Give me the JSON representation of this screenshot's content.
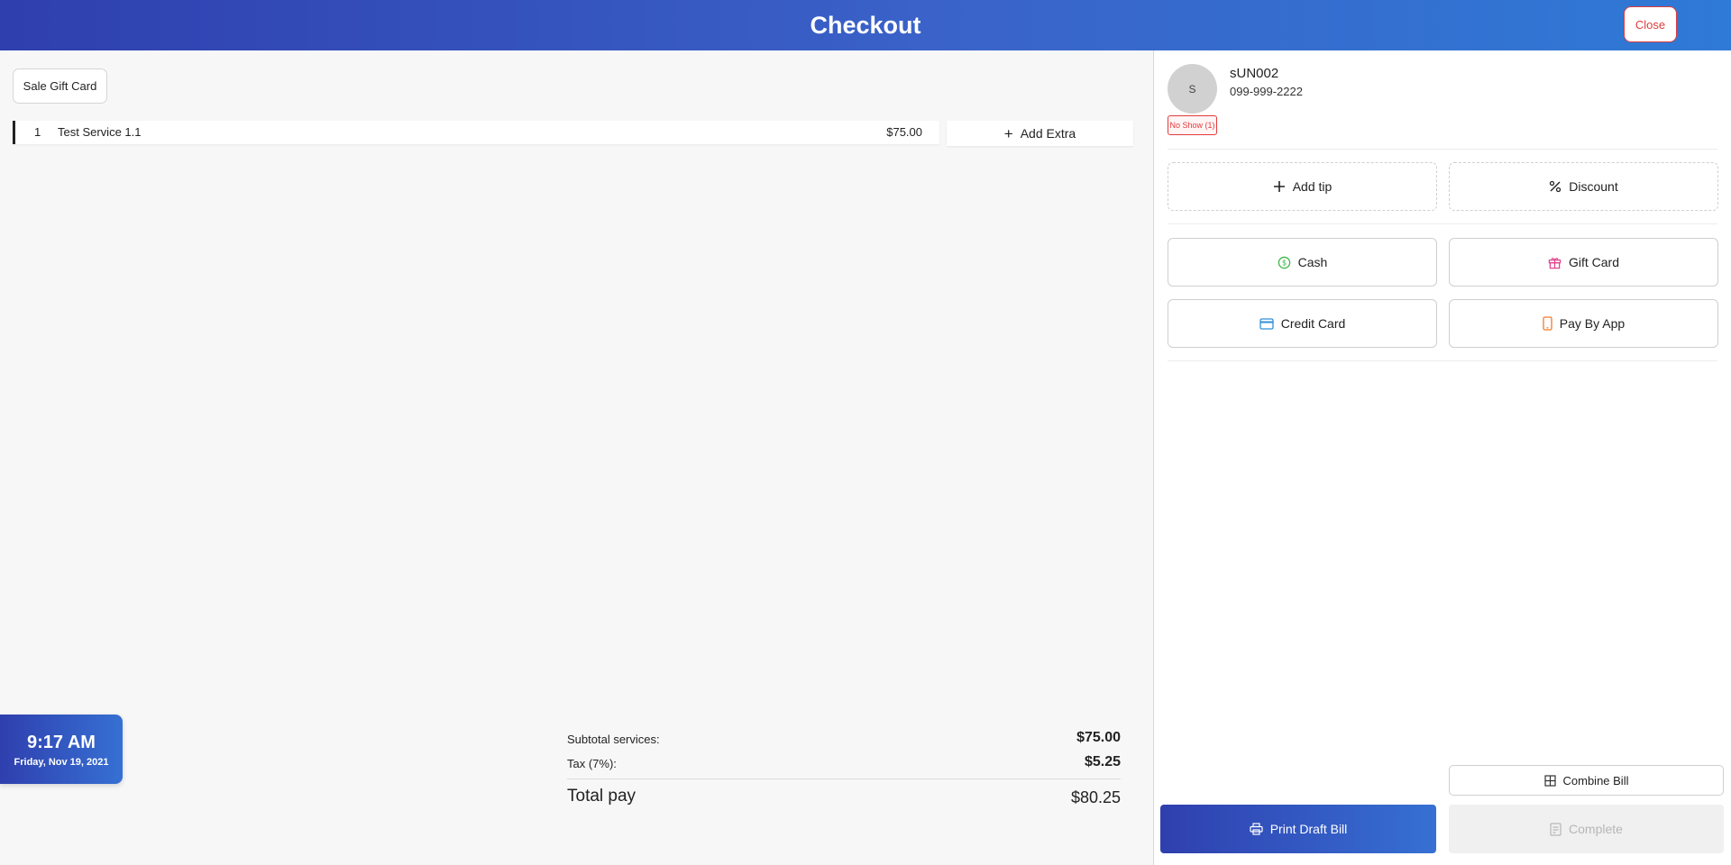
{
  "header": {
    "title": "Checkout",
    "close_label": "Close"
  },
  "left": {
    "sale_gift_card_label": "Sale Gift Card",
    "services": [
      {
        "index": "1",
        "name": "Test Service 1.1",
        "price": "$75.00"
      }
    ],
    "add_extra_label": "Add Extra"
  },
  "clock": {
    "time": "9:17 AM",
    "date": "Friday, Nov 19, 2021"
  },
  "totals": {
    "subtotal_label": "Subtotal services:",
    "subtotal_value": "$75.00",
    "tax_label": "Tax (7%):",
    "tax_value": "$5.25",
    "total_label": "Total pay",
    "total_value": "$80.25"
  },
  "customer": {
    "avatar_initial": "S",
    "name": "sUN002",
    "phone": "099-999-2222",
    "no_show_badge": "No Show (1)"
  },
  "options": {
    "add_tip_label": "Add tip",
    "discount_label": "Discount"
  },
  "payments": {
    "cash_label": "Cash",
    "gift_card_label": "Gift Card",
    "credit_card_label": "Credit Card",
    "pay_by_app_label": "Pay By App"
  },
  "actions": {
    "combine_bill_label": "Combine Bill",
    "print_draft_label": "Print Draft Bill",
    "complete_label": "Complete"
  },
  "colors": {
    "brand_blue": "#2f3fae",
    "danger": "#e23b3b",
    "cash_green": "#3bb54a",
    "gift_pink": "#e0408a",
    "card_blue": "#2f8fd8",
    "app_orange": "#f07b2a"
  }
}
